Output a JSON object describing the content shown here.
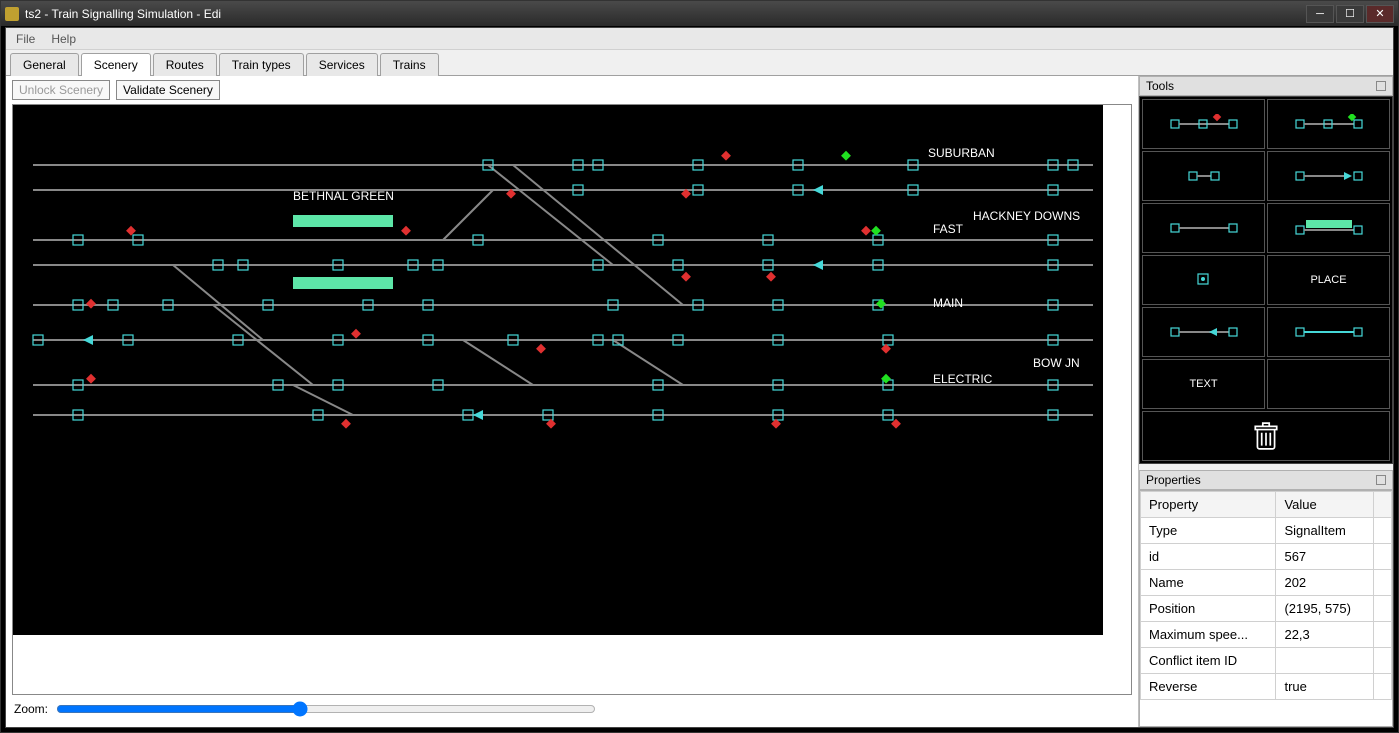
{
  "window": {
    "title": "ts2 - Train Signalling Simulation - Edi"
  },
  "menu": {
    "file": "File",
    "help": "Help"
  },
  "tabs": [
    {
      "label": "General"
    },
    {
      "label": "Scenery"
    },
    {
      "label": "Routes"
    },
    {
      "label": "Train types"
    },
    {
      "label": "Services"
    },
    {
      "label": "Trains"
    }
  ],
  "active_tab": "Scenery",
  "scenery": {
    "unlock": "Unlock Scenery",
    "validate": "Validate Scenery"
  },
  "zoom": {
    "label": "Zoom:"
  },
  "labels": {
    "bethnal": "BETHNAL GREEN",
    "suburban": "SUBURBAN",
    "hackney": "HACKNEY DOWNS",
    "fast": "FAST",
    "main": "MAIN",
    "bowjn": "BOW JN",
    "electric": "ELECTRIC"
  },
  "tools": {
    "title": "Tools",
    "place": "PLACE",
    "text": "TEXT"
  },
  "properties": {
    "title": "Properties",
    "headers": {
      "prop": "Property",
      "val": "Value"
    },
    "rows": [
      {
        "p": "Type",
        "v": "SignalItem"
      },
      {
        "p": "id",
        "v": "567"
      },
      {
        "p": "Name",
        "v": "202"
      },
      {
        "p": "Position",
        "v": "(2195, 575)"
      },
      {
        "p": "Maximum spee...",
        "v": "22,3"
      },
      {
        "p": "Conflict item ID",
        "v": ""
      },
      {
        "p": "Reverse",
        "v": "true"
      }
    ]
  }
}
